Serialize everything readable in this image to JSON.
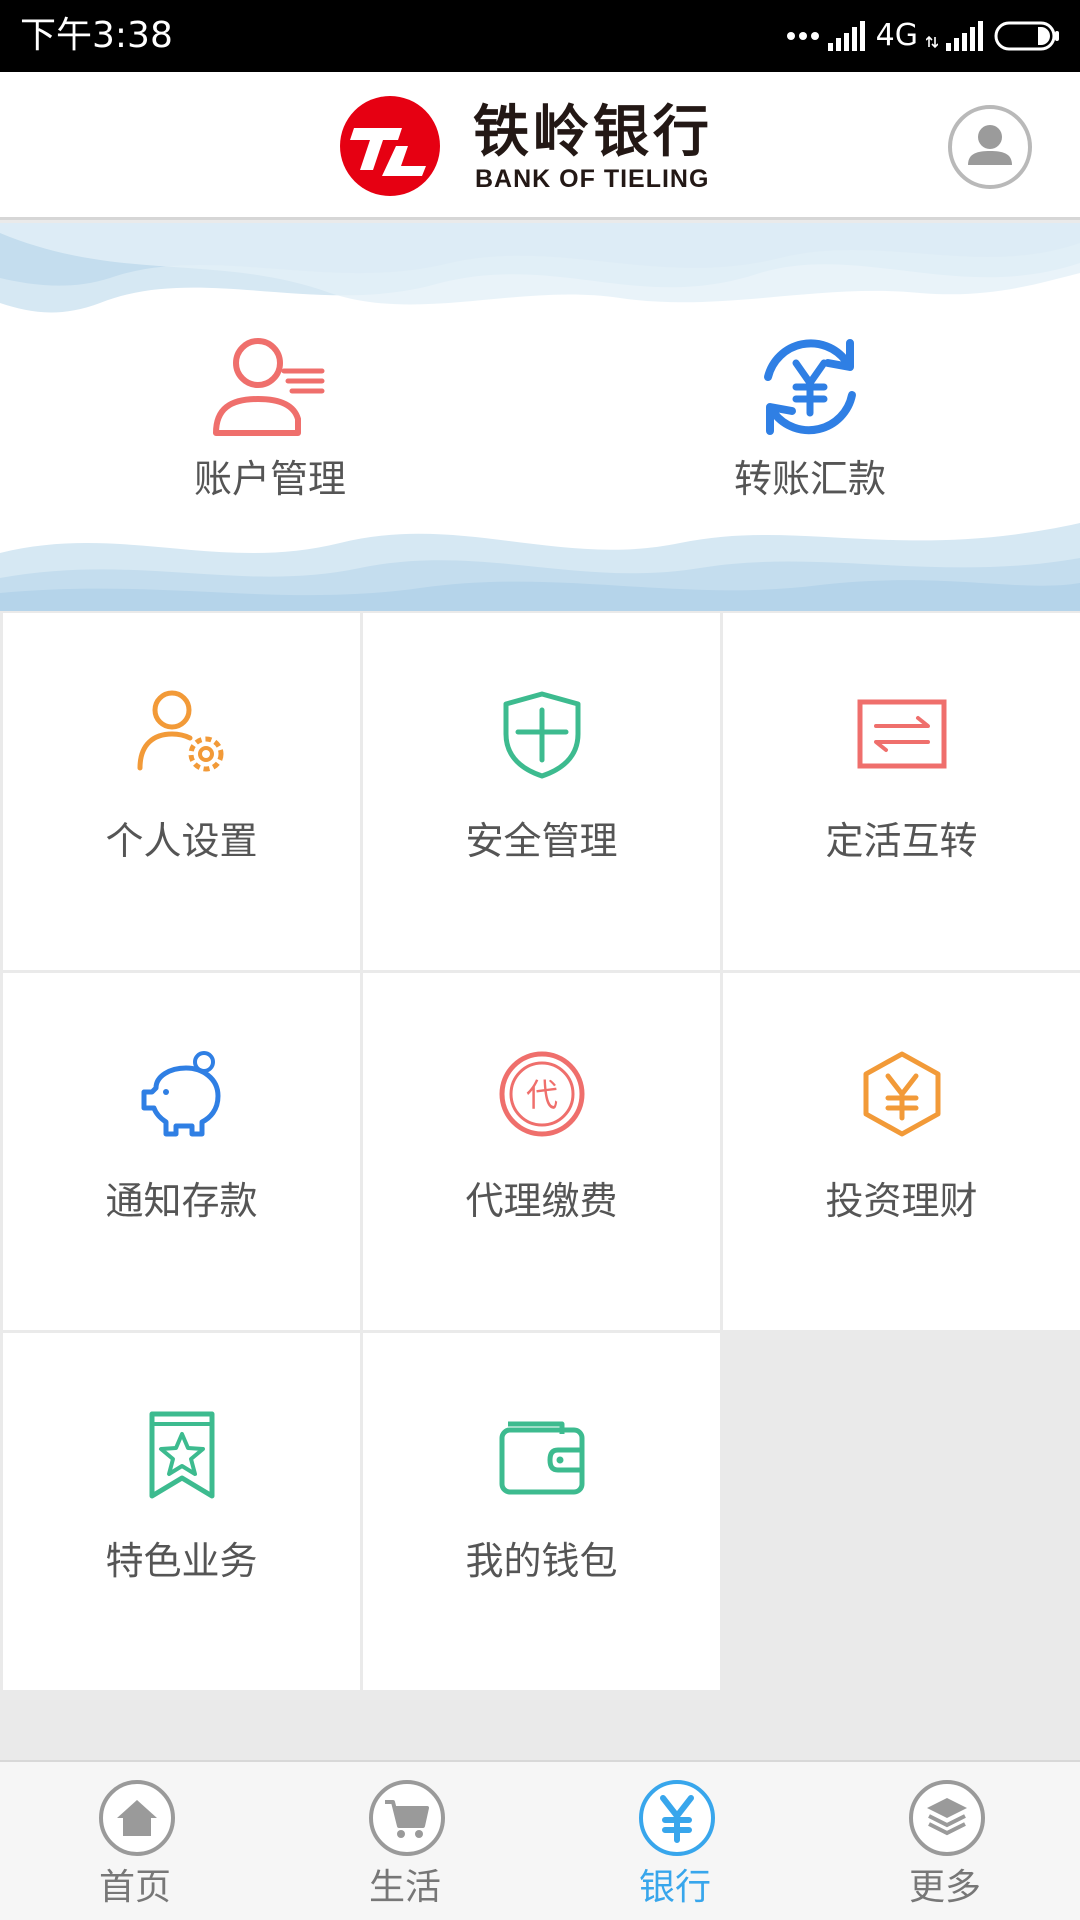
{
  "status_bar": {
    "time": "下午3:38",
    "network": "4G"
  },
  "header": {
    "bank_name_cn": "铁岭银行",
    "bank_name_en": "BANK OF TIELING"
  },
  "banner": {
    "items": [
      {
        "label": "账户管理",
        "icon": "account-user-icon",
        "color": "#ef6f6c"
      },
      {
        "label": "转账汇款",
        "icon": "transfer-yuan-icon",
        "color": "#2f7fe4"
      }
    ]
  },
  "grid": {
    "items": [
      {
        "label": "个人设置",
        "icon": "person-gear-icon",
        "color": "#f29a38"
      },
      {
        "label": "安全管理",
        "icon": "shield-icon",
        "color": "#3dbb8f"
      },
      {
        "label": "定活互转",
        "icon": "exchange-icon",
        "color": "#ef6f6c"
      },
      {
        "label": "通知存款",
        "icon": "piggy-bank-icon",
        "color": "#2f7fe4"
      },
      {
        "label": "代理缴费",
        "icon": "proxy-payment-icon",
        "color": "#ef6f6c",
        "glyph": "代"
      },
      {
        "label": "投资理财",
        "icon": "hexagon-yuan-icon",
        "color": "#f29a38"
      },
      {
        "label": "特色业务",
        "icon": "star-bookmark-icon",
        "color": "#3dbb8f"
      },
      {
        "label": "我的钱包",
        "icon": "wallet-icon",
        "color": "#3dbb8f"
      }
    ]
  },
  "bottom_nav": {
    "items": [
      {
        "label": "首页",
        "icon": "home-icon"
      },
      {
        "label": "生活",
        "icon": "cart-icon"
      },
      {
        "label": "银行",
        "icon": "yuan-icon",
        "active": true
      },
      {
        "label": "更多",
        "icon": "layers-icon"
      }
    ],
    "active_color": "#38a6ec",
    "inactive_color": "#9a9a9a"
  }
}
